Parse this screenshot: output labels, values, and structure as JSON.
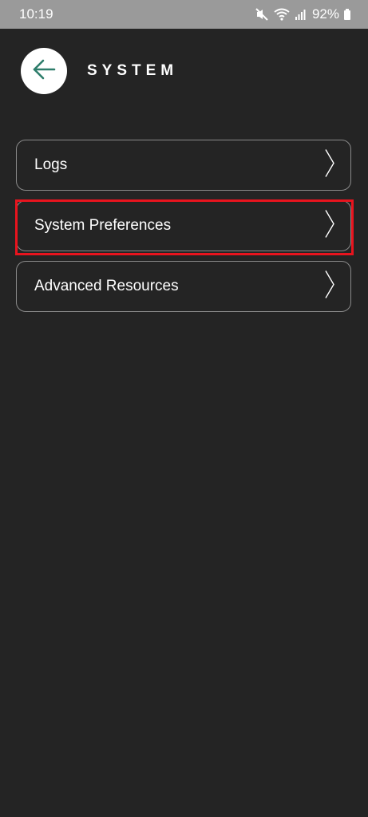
{
  "status_bar": {
    "time": "10:19",
    "battery": "92%",
    "icons": [
      "mute-icon",
      "wifi-icon",
      "signal-icon",
      "battery-icon"
    ]
  },
  "header": {
    "back_icon": "arrow-left-icon",
    "title": "SYSTEM"
  },
  "menu": {
    "items": [
      {
        "label": "Logs",
        "icon": "chevron-right-icon"
      },
      {
        "label": "System Preferences",
        "icon": "chevron-right-icon",
        "highlighted": true
      },
      {
        "label": "Advanced Resources",
        "icon": "chevron-right-icon"
      }
    ]
  },
  "colors": {
    "background": "#242424",
    "status_bar": "#9a9a9a",
    "accent_teal": "#2e7d6b",
    "highlight": "#e8141e",
    "border": "#8a8a8a"
  }
}
